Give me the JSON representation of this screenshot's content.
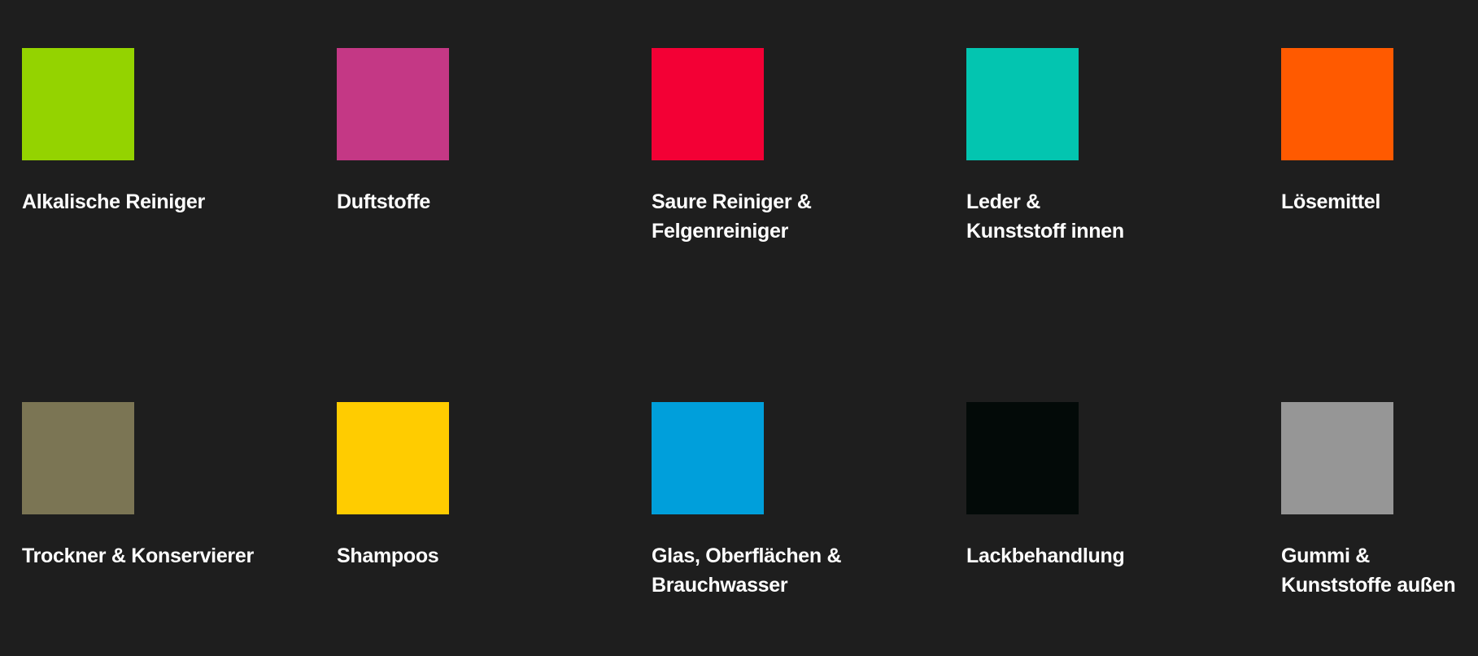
{
  "categories": [
    {
      "label": "Alkalische Reiniger",
      "color": "#94d300"
    },
    {
      "label": "Duftstoffe",
      "color": "#c43885"
    },
    {
      "label": "Saure Reiniger &\nFelgenreiniger",
      "color": "#f30035"
    },
    {
      "label": "Leder &\nKunststoff innen",
      "color": "#03c5b0"
    },
    {
      "label": "Lösemittel",
      "color": "#ff5a00"
    },
    {
      "label": "Trockner & Konservierer",
      "color": "#7b7554"
    },
    {
      "label": "Shampoos",
      "color": "#ffcc00"
    },
    {
      "label": "Glas, Oberflächen &\nBrauchwasser",
      "color": "#009fdb"
    },
    {
      "label": "Lackbehandlung",
      "color": "#030a08"
    },
    {
      "label": "Gummi &\nKunststoffe außen",
      "color": "#969696"
    }
  ]
}
